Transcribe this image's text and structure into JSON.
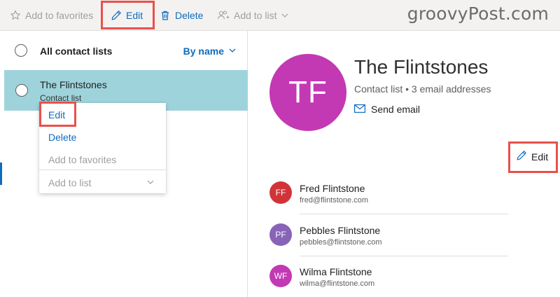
{
  "toolbar": {
    "add_to_favorites": "Add to favorites",
    "edit": "Edit",
    "delete": "Delete",
    "add_to_list": "Add to list"
  },
  "watermark": "groovyPost.com",
  "list": {
    "header_title": "All contact lists",
    "sort_label": "By name",
    "selected_item": {
      "name": "The Flintstones",
      "subtitle": "Contact list"
    }
  },
  "context_menu": {
    "items": [
      "Edit",
      "Delete",
      "Add to favorites",
      "Add to list"
    ]
  },
  "detail": {
    "initials": "TF",
    "name": "The Flintstones",
    "subtitle": "Contact list • 3 email addresses",
    "send_email": "Send email",
    "edit": "Edit",
    "members": [
      {
        "initials": "FF",
        "name": "Fred Flintstone",
        "email": "fred@flintstone.com",
        "color": "#d13438"
      },
      {
        "initials": "PF",
        "name": "Pebbles Flintstone",
        "email": "pebbles@flintstone.com",
        "color": "#8764b8"
      },
      {
        "initials": "WF",
        "name": "Wilma Flintstone",
        "email": "wilma@flintstone.com",
        "color": "#c239b3"
      }
    ]
  },
  "colors": {
    "accent": "#0f6cbd",
    "selected_row": "#9fd3dc",
    "highlight": "#e8514c",
    "group_avatar": "#c239b3"
  },
  "icons": [
    "star-icon",
    "pencil-icon",
    "trash-icon",
    "add-people-icon",
    "chevron-down-icon",
    "mail-icon"
  ]
}
